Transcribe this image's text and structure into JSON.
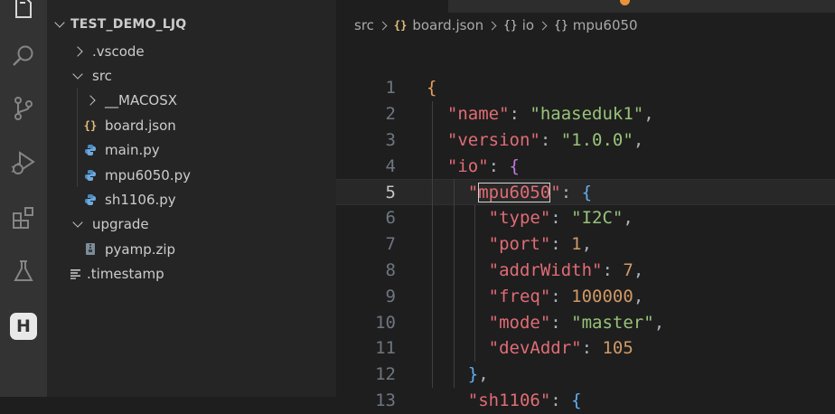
{
  "explorer": {
    "project_title": "TEST_DEMO_LJQ",
    "items": [
      {
        "label": ".vscode",
        "kind": "folder",
        "expanded": false,
        "depth": 0
      },
      {
        "label": "src",
        "kind": "folder",
        "expanded": true,
        "depth": 0
      },
      {
        "label": "__MACOSX",
        "kind": "folder",
        "expanded": false,
        "depth": 1
      },
      {
        "label": "board.json",
        "kind": "json",
        "depth": 1,
        "icon": "{}"
      },
      {
        "label": "main.py",
        "kind": "python",
        "depth": 1
      },
      {
        "label": "mpu6050.py",
        "kind": "python",
        "depth": 1
      },
      {
        "label": "sh1106.py",
        "kind": "python",
        "depth": 1
      },
      {
        "label": "upgrade",
        "kind": "folder",
        "expanded": true,
        "depth": 0
      },
      {
        "label": "pyamp.zip",
        "kind": "zip",
        "depth": 1
      },
      {
        "label": ".timestamp",
        "kind": "text",
        "depth": 0
      }
    ]
  },
  "activity_bar": {
    "icons": [
      "explorer-icon",
      "search-icon",
      "source-control-icon",
      "run-debug-icon",
      "extensions-icon",
      "testing-icon",
      "haas-icon"
    ],
    "haas_label": "H"
  },
  "breadcrumb": {
    "items": [
      {
        "label": "src",
        "icon": ""
      },
      {
        "label": "board.json",
        "icon": "{}"
      },
      {
        "label": "io",
        "icon": "{}"
      },
      {
        "label": "mpu6050",
        "icon": "{}"
      }
    ]
  },
  "editor": {
    "active_line": 5,
    "line_numbers": [
      "1",
      "2",
      "3",
      "4",
      "5",
      "6",
      "7",
      "8",
      "9",
      "10",
      "11",
      "12",
      "13"
    ],
    "lines": [
      {
        "t": [
          [
            "b1",
            "{"
          ]
        ]
      },
      {
        "t": [
          [
            "p",
            "  "
          ],
          [
            "k",
            "\"name\""
          ],
          [
            "p",
            ": "
          ],
          [
            "s",
            "\"haaseduk1\""
          ],
          [
            "p",
            ","
          ]
        ]
      },
      {
        "t": [
          [
            "p",
            "  "
          ],
          [
            "k",
            "\"version\""
          ],
          [
            "p",
            ": "
          ],
          [
            "s",
            "\"1.0.0\""
          ],
          [
            "p",
            ","
          ]
        ]
      },
      {
        "t": [
          [
            "p",
            "  "
          ],
          [
            "k",
            "\"io\""
          ],
          [
            "p",
            ": "
          ],
          [
            "b2",
            "{"
          ]
        ]
      },
      {
        "t": [
          [
            "p",
            "    "
          ],
          [
            "k",
            "\""
          ],
          [
            "khl",
            "mpu6050"
          ],
          [
            "k",
            "\""
          ],
          [
            "p",
            ": "
          ],
          [
            "b3",
            "{"
          ]
        ]
      },
      {
        "t": [
          [
            "p",
            "      "
          ],
          [
            "k",
            "\"type\""
          ],
          [
            "p",
            ": "
          ],
          [
            "s",
            "\"I2C\""
          ],
          [
            "p",
            ","
          ]
        ]
      },
      {
        "t": [
          [
            "p",
            "      "
          ],
          [
            "k",
            "\"port\""
          ],
          [
            "p",
            ": "
          ],
          [
            "n",
            "1"
          ],
          [
            "p",
            ","
          ]
        ]
      },
      {
        "t": [
          [
            "p",
            "      "
          ],
          [
            "k",
            "\"addrWidth\""
          ],
          [
            "p",
            ": "
          ],
          [
            "n",
            "7"
          ],
          [
            "p",
            ","
          ]
        ]
      },
      {
        "t": [
          [
            "p",
            "      "
          ],
          [
            "k",
            "\"freq\""
          ],
          [
            "p",
            ": "
          ],
          [
            "n",
            "100000"
          ],
          [
            "p",
            ","
          ]
        ]
      },
      {
        "t": [
          [
            "p",
            "      "
          ],
          [
            "k",
            "\"mode\""
          ],
          [
            "p",
            ": "
          ],
          [
            "s",
            "\"master\""
          ],
          [
            "p",
            ","
          ]
        ]
      },
      {
        "t": [
          [
            "p",
            "      "
          ],
          [
            "k",
            "\"devAddr\""
          ],
          [
            "p",
            ": "
          ],
          [
            "n",
            "105"
          ]
        ]
      },
      {
        "t": [
          [
            "p",
            "    "
          ],
          [
            "b3",
            "}"
          ],
          [
            "p",
            ","
          ]
        ]
      },
      {
        "t": [
          [
            "p",
            "    "
          ],
          [
            "k",
            "\"sh1106\""
          ],
          [
            "p",
            ": "
          ],
          [
            "b3",
            "{"
          ]
        ]
      }
    ]
  },
  "colors": {
    "keyword": "#e06c75",
    "string": "#98c379",
    "number": "#d19a66",
    "json_icon": "#e5c07b",
    "python_icon": "#4b8bbe"
  }
}
